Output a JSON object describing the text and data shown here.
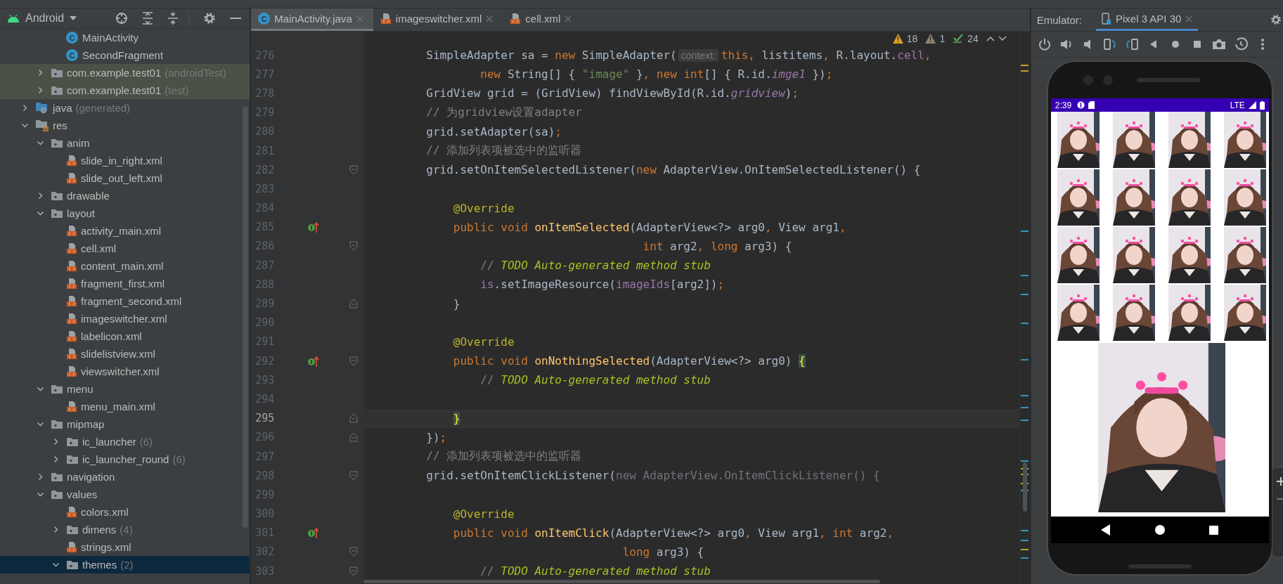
{
  "project_panel": {
    "view": "Android",
    "tree": [
      {
        "kind": "continuation",
        "children": [
          {
            "kind": "continuation",
            "children": [
              {
                "kind": "class",
                "badge": "C",
                "label": "MainActivity",
                "selected": false,
                "test_scope": false
              },
              {
                "kind": "class",
                "badge": "C",
                "label": "SecondFragment",
                "selected": false,
                "test_scope": false
              }
            ]
          },
          {
            "kind": "folder",
            "label": "com.example.test01",
            "note": "(androidTest)",
            "expanded": false,
            "selected": false,
            "test_scope": true
          },
          {
            "kind": "folder",
            "label": "com.example.test01",
            "note": "(test)",
            "expanded": false,
            "selected": false,
            "test_scope": true
          }
        ]
      },
      {
        "kind": "generated",
        "label": "java",
        "note": "(generated)",
        "expanded": false,
        "selected": false,
        "test_scope": false
      },
      {
        "kind": "resources",
        "label": "res",
        "expanded": true,
        "selected": false,
        "test_scope": false,
        "children": [
          {
            "kind": "folder",
            "label": "anim",
            "expanded": true,
            "selected": false,
            "test_scope": false,
            "children": [
              {
                "kind": "xml",
                "label": "slide_in_right.xml",
                "selected": false,
                "test_scope": false
              },
              {
                "kind": "xml",
                "label": "slide_out_left.xml",
                "selected": false,
                "test_scope": false
              }
            ]
          },
          {
            "kind": "folder",
            "label": "drawable",
            "expanded": false,
            "selected": false,
            "test_scope": false
          },
          {
            "kind": "folder",
            "label": "layout",
            "expanded": true,
            "selected": false,
            "test_scope": false,
            "children": [
              {
                "kind": "xml",
                "label": "activity_main.xml",
                "selected": false,
                "test_scope": false
              },
              {
                "kind": "xml",
                "label": "cell.xml",
                "selected": false,
                "test_scope": false
              },
              {
                "kind": "xml",
                "label": "content_main.xml",
                "selected": false,
                "test_scope": false
              },
              {
                "kind": "xml",
                "label": "fragment_first.xml",
                "selected": false,
                "test_scope": false
              },
              {
                "kind": "xml",
                "label": "fragment_second.xml",
                "selected": false,
                "test_scope": false
              },
              {
                "kind": "xml",
                "label": "imageswitcher.xml",
                "selected": false,
                "test_scope": false
              },
              {
                "kind": "xml",
                "label": "labelicon.xml",
                "selected": false,
                "test_scope": false
              },
              {
                "kind": "xml",
                "label": "slidelistview.xml",
                "selected": false,
                "test_scope": false
              },
              {
                "kind": "xml",
                "label": "viewswitcher.xml",
                "selected": false,
                "test_scope": false
              }
            ]
          },
          {
            "kind": "folder",
            "label": "menu",
            "expanded": true,
            "selected": false,
            "test_scope": false,
            "children": [
              {
                "kind": "xml",
                "label": "menu_main.xml",
                "selected": false,
                "test_scope": false
              }
            ]
          },
          {
            "kind": "folder",
            "label": "mipmap",
            "expanded": true,
            "selected": false,
            "test_scope": false,
            "children": [
              {
                "kind": "folder",
                "label": "ic_launcher",
                "note": "(6)",
                "expanded": false,
                "selected": false,
                "test_scope": false
              },
              {
                "kind": "folder",
                "label": "ic_launcher_round",
                "note": "(6)",
                "expanded": false,
                "selected": false,
                "test_scope": false
              }
            ]
          },
          {
            "kind": "folder",
            "label": "navigation",
            "expanded": false,
            "selected": false,
            "test_scope": false
          },
          {
            "kind": "folder",
            "label": "values",
            "expanded": true,
            "selected": false,
            "test_scope": false,
            "children": [
              {
                "kind": "xml",
                "label": "colors.xml",
                "selected": false,
                "test_scope": false
              },
              {
                "kind": "folder",
                "label": "dimens",
                "note": "(4)",
                "expanded": false,
                "selected": false,
                "test_scope": false
              },
              {
                "kind": "xml",
                "label": "strings.xml",
                "selected": false,
                "test_scope": false
              },
              {
                "kind": "folder",
                "label": "themes",
                "note": "(2)",
                "expanded": true,
                "selected": true,
                "test_scope": false
              }
            ]
          }
        ]
      }
    ]
  },
  "editor": {
    "tabs": [
      {
        "kind": "class",
        "badge": "C",
        "label": "MainActivity.java",
        "selected": true
      },
      {
        "kind": "xml",
        "label": "imageswitcher.xml",
        "selected": false
      },
      {
        "kind": "xml",
        "label": "cell.xml",
        "selected": false
      }
    ],
    "inspections": {
      "warnings": "18",
      "weak_warnings": "1",
      "typos": "24"
    },
    "lines": [
      {
        "number": "276",
        "current": false,
        "segments": [
          {
            "kind": "plain",
            "text": "        SimpleAdapter sa = "
          },
          {
            "kind": "keyword",
            "text": "new"
          },
          {
            "kind": "plain",
            "text": " SimpleAdapter("
          },
          {
            "kind": "hint",
            "text": "context:"
          },
          {
            "kind": "keyword",
            "text": "this"
          },
          {
            "kind": "punct",
            "text": ","
          },
          {
            "kind": "plain",
            "text": " listitems"
          },
          {
            "kind": "punct",
            "text": ","
          },
          {
            "kind": "plain",
            "text": " R.layout."
          },
          {
            "kind": "field",
            "text": "cell"
          },
          {
            "kind": "punct",
            "text": ","
          }
        ]
      },
      {
        "number": "277",
        "current": false,
        "segments": [
          {
            "kind": "keyword",
            "text": "                new"
          },
          {
            "kind": "plain",
            "text": " String[] { "
          },
          {
            "kind": "string",
            "text": "\"image\""
          },
          {
            "kind": "plain",
            "text": " }"
          },
          {
            "kind": "punct",
            "text": ","
          },
          {
            "kind": "keyword",
            "text": " new int"
          },
          {
            "kind": "plain",
            "text": "[] { R.id."
          },
          {
            "kind": "field_italic",
            "text": "imge1"
          },
          {
            "kind": "plain",
            "text": " })"
          },
          {
            "kind": "punct",
            "text": ";"
          }
        ]
      },
      {
        "number": "278",
        "current": false,
        "segments": [
          {
            "kind": "plain",
            "text": "        GridView grid = (GridView) findViewById(R.id."
          },
          {
            "kind": "field_italic",
            "text": "gridview"
          },
          {
            "kind": "plain",
            "text": ")"
          },
          {
            "kind": "punct",
            "text": ";"
          }
        ]
      },
      {
        "number": "279",
        "current": false,
        "segments": [
          {
            "kind": "comment",
            "text": "        // 为gridview设置adapter"
          }
        ]
      },
      {
        "number": "280",
        "current": false,
        "segments": [
          {
            "kind": "plain",
            "text": "        grid.setAdapter(sa)"
          },
          {
            "kind": "punct",
            "text": ";"
          }
        ]
      },
      {
        "number": "281",
        "current": false,
        "segments": [
          {
            "kind": "comment",
            "text": "        // 添加列表项被选中的监听器"
          }
        ]
      },
      {
        "number": "282",
        "current": false,
        "gutter": [
          {
            "kind": "fold_open"
          }
        ],
        "segments": [
          {
            "kind": "plain",
            "text": "        grid.setOnItemSelectedListener("
          },
          {
            "kind": "keyword",
            "text": "new"
          },
          {
            "kind": "plain",
            "text": " AdapterView.OnItemSelectedListener() {"
          }
        ]
      },
      {
        "number": "283",
        "current": false
      },
      {
        "number": "284",
        "current": false,
        "segments": [
          {
            "kind": "annotation",
            "text": "            @Override"
          }
        ]
      },
      {
        "number": "285",
        "current": false,
        "gutter": [
          {
            "kind": "override"
          }
        ],
        "segments": [
          {
            "kind": "keyword",
            "text": "            public void"
          },
          {
            "kind": "method",
            "text": " onItemSelected"
          },
          {
            "kind": "plain",
            "text": "(AdapterView<?> arg0"
          },
          {
            "kind": "punct",
            "text": ","
          },
          {
            "kind": "plain",
            "text": " View arg1"
          },
          {
            "kind": "punct",
            "text": ","
          }
        ]
      },
      {
        "number": "286",
        "current": false,
        "gutter": [
          {
            "kind": "fold_open"
          }
        ],
        "segments": [
          {
            "kind": "keyword",
            "text": "                                        int"
          },
          {
            "kind": "plain",
            "text": " arg2"
          },
          {
            "kind": "punct",
            "text": ","
          },
          {
            "kind": "keyword",
            "text": " long"
          },
          {
            "kind": "plain",
            "text": " arg3) {"
          }
        ]
      },
      {
        "number": "287",
        "current": false,
        "segments": [
          {
            "kind": "comment",
            "text": "                // "
          },
          {
            "kind": "todo",
            "text": "TODO Auto-generated method stub"
          }
        ]
      },
      {
        "number": "288",
        "current": false,
        "segments": [
          {
            "kind": "field",
            "text": "                is"
          },
          {
            "kind": "plain",
            "text": ".setImageResource("
          },
          {
            "kind": "field",
            "text": "imageIds"
          },
          {
            "kind": "plain",
            "text": "[arg2])"
          },
          {
            "kind": "punct",
            "text": ";"
          }
        ]
      },
      {
        "number": "289",
        "current": false,
        "gutter": [
          {
            "kind": "fold_close"
          }
        ],
        "segments": [
          {
            "kind": "plain",
            "text": "            }"
          }
        ]
      },
      {
        "number": "290",
        "current": false
      },
      {
        "number": "291",
        "current": false,
        "segments": [
          {
            "kind": "annotation",
            "text": "            @Override"
          }
        ]
      },
      {
        "number": "292",
        "current": false,
        "gutter": [
          {
            "kind": "override"
          },
          {
            "kind": "fold_open"
          }
        ],
        "segments": [
          {
            "kind": "keyword",
            "text": "            public void"
          },
          {
            "kind": "method",
            "text": " onNothingSelected"
          },
          {
            "kind": "plain",
            "text": "(AdapterView<?> arg0) "
          },
          {
            "kind": "brace_match",
            "text": "{"
          }
        ]
      },
      {
        "number": "293",
        "current": false,
        "segments": [
          {
            "kind": "comment",
            "text": "                // "
          },
          {
            "kind": "todo",
            "text": "TODO Auto-generated method stub"
          }
        ]
      },
      {
        "number": "294",
        "current": false
      },
      {
        "number": "295",
        "current": true,
        "gutter": [
          {
            "kind": "fold_close"
          }
        ],
        "segments": [
          {
            "kind": "brace_match",
            "text": "            }"
          }
        ]
      },
      {
        "number": "296",
        "current": false,
        "gutter": [
          {
            "kind": "fold_close"
          }
        ],
        "segments": [
          {
            "kind": "plain",
            "text": "        })"
          },
          {
            "kind": "punct",
            "text": ";"
          }
        ]
      },
      {
        "number": "297",
        "current": false,
        "segments": [
          {
            "kind": "comment",
            "text": "        // 添加列表项被选中的监听器"
          }
        ]
      },
      {
        "number": "298",
        "current": false,
        "gutter": [
          {
            "kind": "fold_open"
          }
        ],
        "segments": [
          {
            "kind": "plain",
            "text": "        grid.setOnItemClickListener("
          },
          {
            "kind": "dim",
            "text": "new AdapterView.OnItemClickListener() {"
          }
        ]
      },
      {
        "number": "299",
        "current": false
      },
      {
        "number": "300",
        "current": false,
        "segments": [
          {
            "kind": "annotation",
            "text": "            @Override"
          }
        ]
      },
      {
        "number": "301",
        "current": false,
        "gutter": [
          {
            "kind": "override"
          }
        ],
        "segments": [
          {
            "kind": "keyword",
            "text": "            public void"
          },
          {
            "kind": "method",
            "text": " onItemClick"
          },
          {
            "kind": "plain",
            "text": "(AdapterView<?> arg0"
          },
          {
            "kind": "punct",
            "text": ","
          },
          {
            "kind": "plain",
            "text": " View arg1"
          },
          {
            "kind": "punct",
            "text": ","
          },
          {
            "kind": "keyword",
            "text": " int"
          },
          {
            "kind": "plain",
            "text": " arg2"
          },
          {
            "kind": "punct",
            "text": ","
          }
        ]
      },
      {
        "number": "302",
        "current": false,
        "gutter": [
          {
            "kind": "fold_open"
          }
        ],
        "segments": [
          {
            "kind": "keyword",
            "text": "                                     long"
          },
          {
            "kind": "plain",
            "text": " arg3) {"
          }
        ]
      },
      {
        "number": "303",
        "current": false,
        "gutter": [
          {
            "kind": "fold_open"
          }
        ],
        "segments": [
          {
            "kind": "comment",
            "text": "                // "
          },
          {
            "kind": "todo",
            "text": "TODO Auto-generated method stub"
          }
        ]
      }
    ]
  },
  "emulator": {
    "label": "Emulator:",
    "tabs": [
      {
        "label": "Pixel 3 API 30",
        "selected": true
      }
    ],
    "device": {
      "time": "2:39",
      "network": "LTE"
    }
  }
}
